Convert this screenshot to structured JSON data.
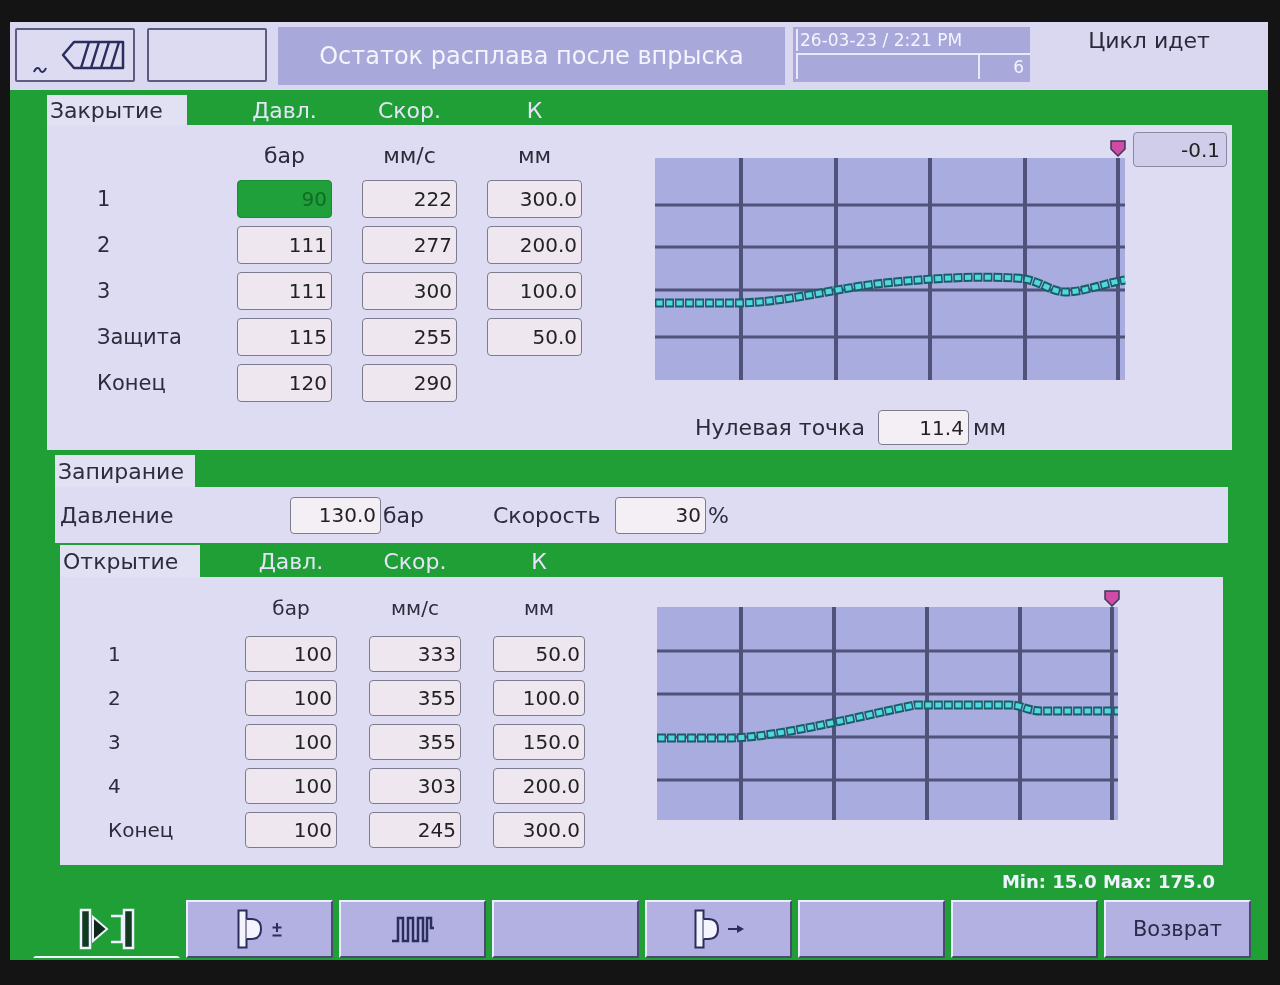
{
  "header": {
    "title": "Остаток расплава после впрыска",
    "datetime": "26-03-23 / 2:21 PM",
    "counter": "6",
    "status": "Цикл идет"
  },
  "closing": {
    "title": "Закрытие",
    "columns": [
      "Давл.",
      "Скор.",
      "К"
    ],
    "units": [
      "бар",
      "мм/с",
      "мм"
    ],
    "rows": [
      {
        "label": "1",
        "cells": [
          {
            "value": "90",
            "selected": true
          },
          {
            "value": "222",
            "selected": false
          },
          {
            "value": "300.0",
            "selected": false
          }
        ]
      },
      {
        "label": "2",
        "cells": [
          {
            "value": "111",
            "selected": false
          },
          {
            "value": "277",
            "selected": false
          },
          {
            "value": "200.0",
            "selected": false
          }
        ]
      },
      {
        "label": "3",
        "cells": [
          {
            "value": "111",
            "selected": false
          },
          {
            "value": "300",
            "selected": false
          },
          {
            "value": "100.0",
            "selected": false
          }
        ]
      },
      {
        "label": "Защита",
        "cells": [
          {
            "value": "115",
            "selected": false
          },
          {
            "value": "255",
            "selected": false
          },
          {
            "value": "50.0",
            "selected": false
          }
        ]
      },
      {
        "label": "Конец",
        "cells": [
          {
            "value": "120",
            "selected": false
          },
          {
            "value": "290",
            "selected": false
          }
        ]
      }
    ],
    "readout": "-0.1",
    "zero_point": {
      "label": "Нулевая точка",
      "value": "11.4",
      "unit": "мм"
    }
  },
  "locking": {
    "title": "Запирание",
    "fields": [
      {
        "label": "Давление",
        "value": "130.0",
        "unit": "бар"
      },
      {
        "label": "Скорость",
        "value": "30",
        "unit": "%"
      }
    ]
  },
  "opening": {
    "title": "Открытие",
    "columns": [
      "Давл.",
      "Скор.",
      "К"
    ],
    "units": [
      "бар",
      "мм/с",
      "мм"
    ],
    "rows": [
      {
        "label": "1",
        "cells": [
          {
            "value": "100",
            "selected": false
          },
          {
            "value": "333",
            "selected": false
          },
          {
            "value": "50.0",
            "selected": false
          }
        ]
      },
      {
        "label": "2",
        "cells": [
          {
            "value": "100",
            "selected": false
          },
          {
            "value": "355",
            "selected": false
          },
          {
            "value": "100.0",
            "selected": false
          }
        ]
      },
      {
        "label": "3",
        "cells": [
          {
            "value": "100",
            "selected": false
          },
          {
            "value": "355",
            "selected": false
          },
          {
            "value": "150.0",
            "selected": false
          }
        ]
      },
      {
        "label": "4",
        "cells": [
          {
            "value": "100",
            "selected": false
          },
          {
            "value": "303",
            "selected": false
          },
          {
            "value": "200.0",
            "selected": false
          }
        ]
      },
      {
        "label": "Конец",
        "cells": [
          {
            "value": "100",
            "selected": false
          },
          {
            "value": "245",
            "selected": false
          },
          {
            "value": "300.0",
            "selected": false
          }
        ]
      }
    ]
  },
  "limits": "Min: 15.0 Max: 175.0",
  "toolbar": [
    {
      "kind": "clamp",
      "selected": true
    },
    {
      "kind": "adjust",
      "selected": false
    },
    {
      "kind": "pulse",
      "selected": false
    },
    {
      "kind": "blank",
      "selected": false
    },
    {
      "kind": "advance",
      "selected": false
    },
    {
      "kind": "blank",
      "selected": false
    },
    {
      "kind": "blank",
      "selected": false
    },
    {
      "kind": "label",
      "label": "Возврат",
      "selected": false
    }
  ]
}
